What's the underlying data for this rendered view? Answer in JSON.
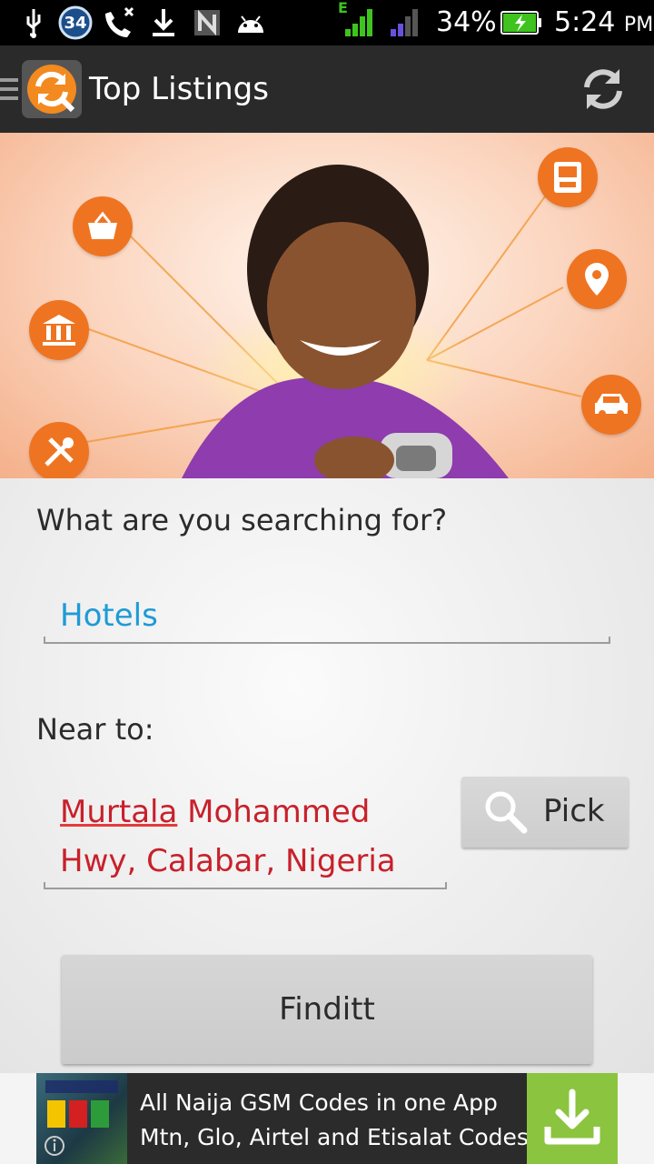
{
  "status_bar": {
    "notification_count": "34",
    "network_type": "E",
    "battery_percent": "34%",
    "time": "5:24",
    "ampm": "PM"
  },
  "action_bar": {
    "title": "Top Listings"
  },
  "form": {
    "search_label": "What are you searching for?",
    "search_value": "Hotels",
    "near_label": "Near to:",
    "location_line1_word1": "Murtala",
    "location_line1_rest": " Mohammed",
    "location_line2": "Hwy, Calabar, Nigeria",
    "pick_label": "Pick",
    "submit_label": "Finditt"
  },
  "ad": {
    "line1": "All Naija GSM Codes in one App",
    "line2": "Mtn, Glo, Airtel and Etisalat Codes"
  },
  "colors": {
    "accent_orange": "#ef7421",
    "search_value_color": "#1e9bd7",
    "location_color": "#c8202a",
    "ad_download_green": "#8bc43f"
  }
}
